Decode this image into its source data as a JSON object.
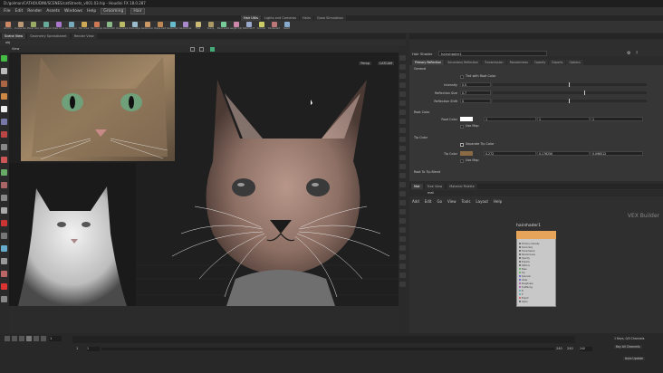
{
  "window": {
    "title": "D:/golman/CATHOUDINI/SCENES/catStreets_v001.03.hip - Houdini FX 18.0.287"
  },
  "menu": {
    "items": [
      "File",
      "Edit",
      "Render",
      "Assets",
      "Windows",
      "Help"
    ],
    "desktop": "Grooming",
    "hair_context": "Hair"
  },
  "shelf_tabs": [
    "Hair Utils",
    "Lights and Cameras",
    "Hairs",
    "Grow Simulation"
  ],
  "shelf_tools": [
    "Add Fur",
    "Curves Groom",
    "Planar Groom",
    "Guide Groom",
    "Draw Curves",
    "Guide Process",
    "Hair Grow",
    "Hair Clump",
    "Guide Deform",
    "Clone Guides",
    "Clone Adjust",
    "Guide Groom",
    "Shape Guides",
    "Guide Process",
    "Guide Brush",
    "Frizz",
    "Clump",
    "Bend Guides",
    "Length Adjust",
    "Deformer Ext",
    "Cut Hair",
    "Deintersect",
    "Select"
  ],
  "pane_tabs": [
    "Scene View",
    "Geometry Spreadsheet",
    "Render View"
  ],
  "path": "obj",
  "viewport": {
    "label": "View",
    "persp_label": "Persp",
    "cam_label": "CATCAM"
  },
  "param_header": {
    "type_label": "Hair Shader",
    "node_name": "hairshader1"
  },
  "param_tabs": [
    "Primary Reflection",
    "Secondary Reflection",
    "Transmission",
    "Randomness",
    "Opacity",
    "Exports",
    "Options"
  ],
  "params": {
    "section_general": "General",
    "tint_label": "Tint with Root Color",
    "intensity_label": "Intensity",
    "intensity": "0.5",
    "refl_size_label": "Reflection Size",
    "refl_size": "0.7",
    "refl_shift_label": "Reflection Shift",
    "refl_shift": "0",
    "section_root": "Root Color",
    "root_color_label": "Root Color",
    "root_r": "1",
    "root_g": "1",
    "root_b": "1",
    "use_map_label": "Use Map",
    "section_tip": "Tip Color",
    "separate_tip_label": "Separate Tip Color",
    "tip_color_label": "Tip Color",
    "tip_r": "0.272",
    "tip_g": "0.176250",
    "tip_b": "0.098512",
    "use_map_label2": "Use Map",
    "section_blend": "Root To Tip Blend"
  },
  "network": {
    "tabs": [
      "Mat",
      "Tree View",
      "Material Palette"
    ],
    "path": "mat",
    "menu": [
      "Add",
      "Edit",
      "Go",
      "View",
      "Tools",
      "Layout",
      "Help"
    ],
    "context_label": "VEX Builder",
    "node_name": "hairshader1",
    "ports": [
      "Primary Intensity",
      "Secondary",
      "Transmission",
      "Randomness",
      "Opacity",
      "Exports",
      "Options",
      "Base",
      "Tip",
      "Specular",
      "Gloss",
      "Roughness",
      "Scattering",
      "N",
      "P",
      "Export",
      "Alpha"
    ]
  },
  "timeline": {
    "frame": "1",
    "start": "1",
    "end": "240",
    "end2": "240",
    "start_field": "1",
    "end_field": "240",
    "keys_label": "1 Keys, 0/0 Channels",
    "key_all": "Key All Channels",
    "auto_update": "Auto Update"
  },
  "colors": {
    "accent": "#e6a35a",
    "shelf_bg": "#333333",
    "viewport_bg": "#1f1f1f",
    "tip_swatch": "#8b6b46",
    "root_swatch": "#ffffff"
  }
}
